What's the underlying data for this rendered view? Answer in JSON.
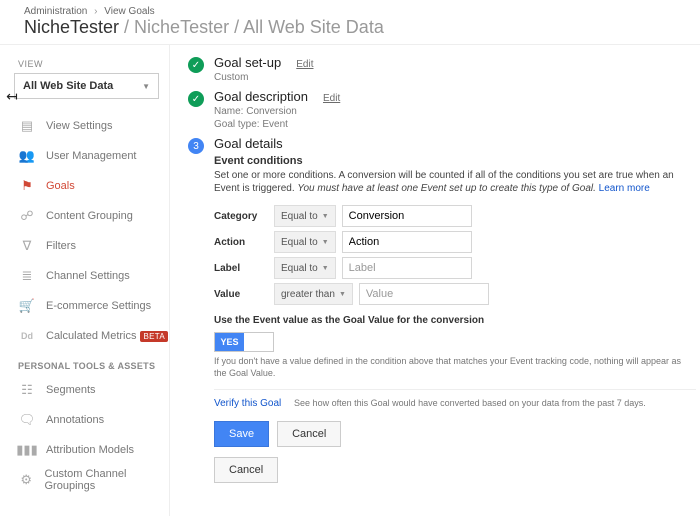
{
  "breadcrumb": {
    "a": "Administration",
    "b": "View Goals"
  },
  "title": {
    "property": "NicheTester",
    "rest": " / NicheTester / All Web Site Data"
  },
  "sidebar": {
    "section_label": "VIEW",
    "selector_value": "All Web Site Data",
    "items": [
      {
        "label": "View Settings"
      },
      {
        "label": "User Management"
      },
      {
        "label": "Goals"
      },
      {
        "label": "Content Grouping"
      },
      {
        "label": "Filters"
      },
      {
        "label": "Channel Settings"
      },
      {
        "label": "E-commerce Settings"
      },
      {
        "label": "Calculated Metrics",
        "beta": "BETA"
      }
    ],
    "tools_header": "PERSONAL TOOLS & ASSETS",
    "tools": [
      {
        "label": "Segments"
      },
      {
        "label": "Annotations"
      },
      {
        "label": "Attribution Models"
      },
      {
        "label": "Custom Channel Groupings"
      }
    ]
  },
  "steps": {
    "s1": {
      "title": "Goal set-up",
      "edit": "Edit",
      "sub": "Custom"
    },
    "s2": {
      "title": "Goal description",
      "edit": "Edit",
      "sub1": "Name: Conversion",
      "sub2": "Goal type: Event"
    },
    "s3": {
      "num": "3",
      "title": "Goal details",
      "sec_title": "Event conditions",
      "sec_text_a": "Set one or more conditions. A conversion will be counted if all of the conditions you set are true when an Event is triggered. ",
      "sec_text_b": "You must have at least one Event set up to create this type of Goal. ",
      "learn": "Learn more"
    }
  },
  "conditions": {
    "rows": [
      {
        "label": "Category",
        "op": "Equal to",
        "value": "Conversion",
        "ph": "Category"
      },
      {
        "label": "Action",
        "op": "Equal to",
        "value": "Action",
        "ph": "Action"
      },
      {
        "label": "Label",
        "op": "Equal to",
        "value": "",
        "ph": "Label"
      },
      {
        "label": "Value",
        "op": "greater than",
        "value": "",
        "ph": "Value"
      }
    ]
  },
  "goalvalue": {
    "question": "Use the Event value as the Goal Value for the conversion",
    "yes": "YES",
    "note": "If you don't have a value defined in the condition above that matches your Event tracking code, nothing will appear as the Goal Value."
  },
  "verify": {
    "link": "Verify this Goal",
    "text": "See how often this Goal would have converted based on your data from the past 7 days."
  },
  "buttons": {
    "save": "Save",
    "cancel": "Cancel",
    "outer_cancel": "Cancel"
  }
}
